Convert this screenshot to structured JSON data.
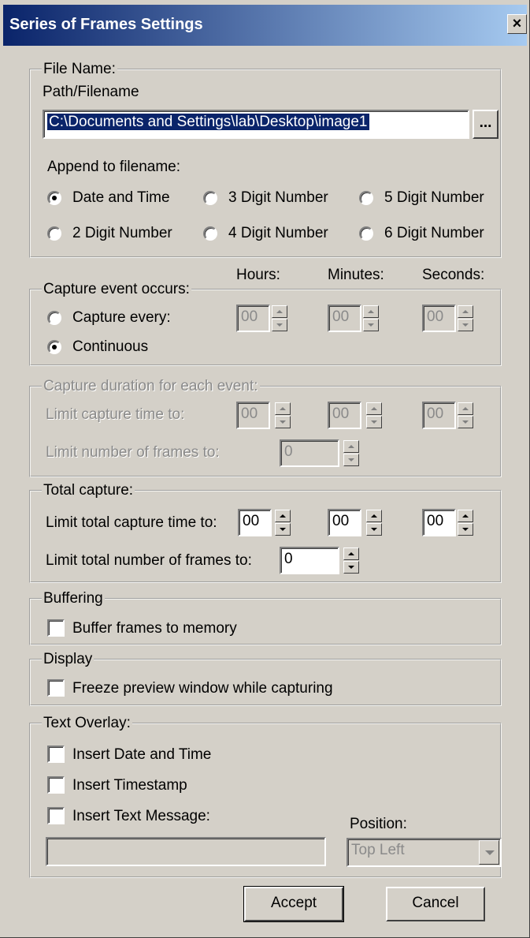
{
  "window": {
    "title": "Series of Frames Settings",
    "close": "×"
  },
  "file": {
    "group_label": "File Name:",
    "path_label": "Path/Filename",
    "path_value": "C:\\Documents and Settings\\lab\\Desktop\\image1",
    "browse_label": "...",
    "append_label": "Append to filename:",
    "options": [
      "Date and Time",
      "3 Digit Number",
      "5 Digit Number",
      "2 Digit Number",
      "4 Digit Number",
      "6 Digit Number"
    ],
    "selected": "Date and Time"
  },
  "units": {
    "hours": "Hours:",
    "minutes": "Minutes:",
    "seconds": "Seconds:"
  },
  "capture_event": {
    "group_label": "Capture event occurs:",
    "every_label": "Capture every:",
    "continuous_label": "Continuous",
    "selected": "Continuous",
    "hours": "00",
    "minutes": "00",
    "seconds": "00"
  },
  "duration": {
    "group_label": "Capture duration for each event:",
    "time_label": "Limit capture time to:",
    "frames_label": "Limit number of frames to:",
    "hours": "00",
    "minutes": "00",
    "seconds": "00",
    "frames": "0"
  },
  "total": {
    "group_label": "Total capture:",
    "time_label": "Limit total capture time to:",
    "frames_label": "Limit total number of frames to:",
    "hours": "00",
    "minutes": "00",
    "seconds": "00",
    "frames": "0"
  },
  "buffering": {
    "group_label": "Buffering",
    "checkbox_label": "Buffer frames to memory",
    "checked": false
  },
  "display": {
    "group_label": "Display",
    "checkbox_label": "Freeze preview window while capturing",
    "checked": false
  },
  "overlay": {
    "group_label": "Text Overlay:",
    "date_time_label": "Insert Date and Time",
    "timestamp_label": "Insert Timestamp",
    "message_label": "Insert Text Message:",
    "message_value": "",
    "position_label": "Position:",
    "position_value": "Top Left"
  },
  "buttons": {
    "accept": "Accept",
    "cancel": "Cancel"
  }
}
